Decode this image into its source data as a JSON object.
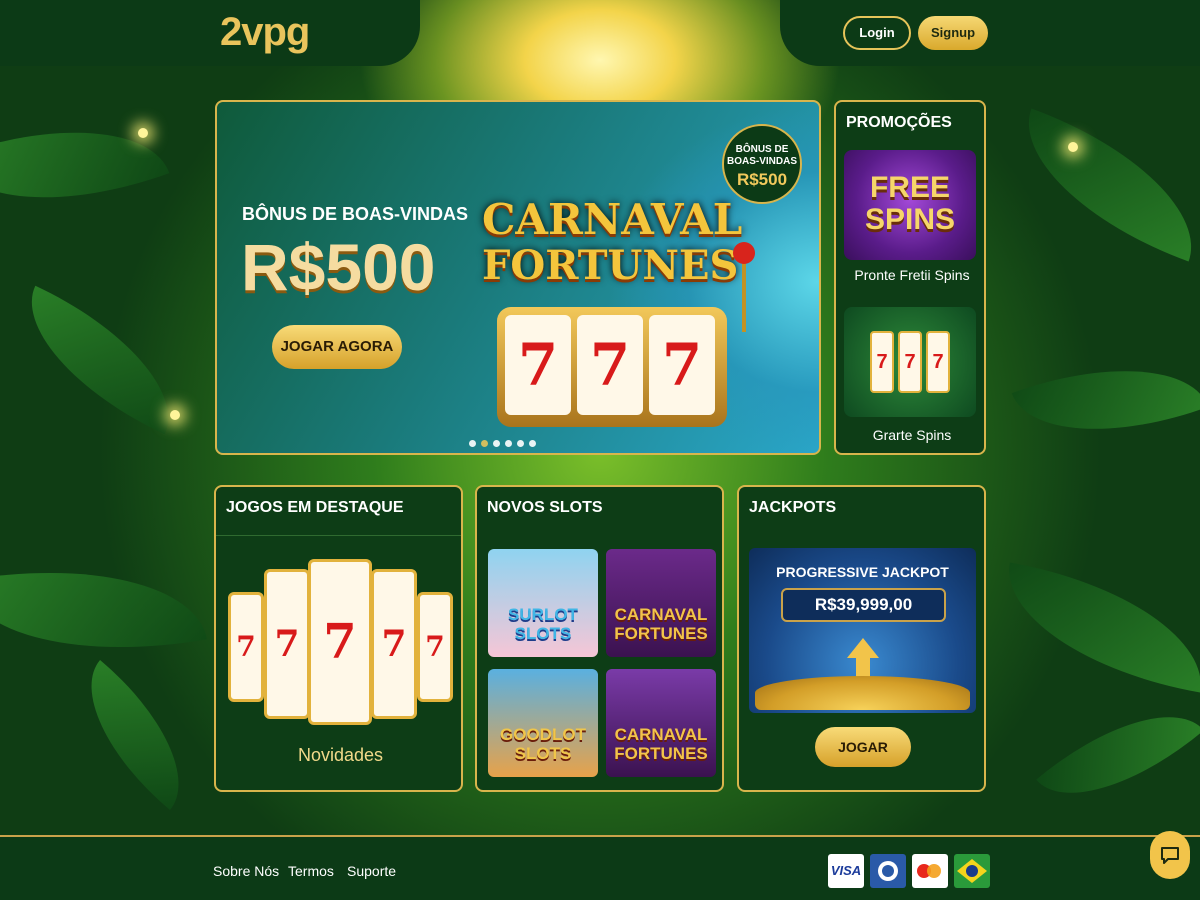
{
  "header": {
    "logo": "2vpg",
    "login_label": "Login",
    "signup_label": "Signup"
  },
  "hero": {
    "subtitle": "BÔNUS DE BOAS-VINDAS",
    "amount": "R$500",
    "cta_label": "JOGAR AGORA",
    "game_title_line1": "CARNAVAL",
    "game_title_line2": "FORTUNES",
    "reels": [
      "7",
      "7",
      "7"
    ],
    "badge_text": "BÔNUS DE BOAS-VINDAS",
    "badge_amount": "R$500",
    "carousel_dots": 6,
    "active_dot": 1
  },
  "promotions": {
    "title": "PROMOÇÕES",
    "items": [
      {
        "art_text": "FREE SPINS",
        "label": "Pronte Fretii Spins"
      },
      {
        "art_reels": [
          "7",
          "7",
          "7"
        ],
        "label": "Grarte Spins"
      }
    ]
  },
  "featured": {
    "title": "JOGOS EM DESTAQUE",
    "reels": [
      "7",
      "7",
      "7",
      "7",
      "7"
    ],
    "label": "Novidades"
  },
  "new_slots": {
    "title": "NOVOS SLOTS",
    "tiles": [
      {
        "title": "SURLOT SLOTS"
      },
      {
        "title": "CARNAVAL FORTUNES"
      },
      {
        "title": "GOODLOT SLOTS"
      },
      {
        "title": "CARNAVAL FORTUNES"
      }
    ]
  },
  "jackpots": {
    "title": "JACKPOTS",
    "jackpot_title": "PROGRESSIVE JACKPOT",
    "amount": "R$39,999,00",
    "play_label": "JOGAR"
  },
  "footer": {
    "links": [
      "Sobre Nós",
      "Termos",
      "Suporte"
    ],
    "payments": [
      "VISA",
      "Diners Club",
      "Mastercard",
      "Brazil"
    ],
    "visa_label": "VISA"
  },
  "colors": {
    "accent_gold": "#e6c45a",
    "panel_green": "#0d3d16"
  }
}
